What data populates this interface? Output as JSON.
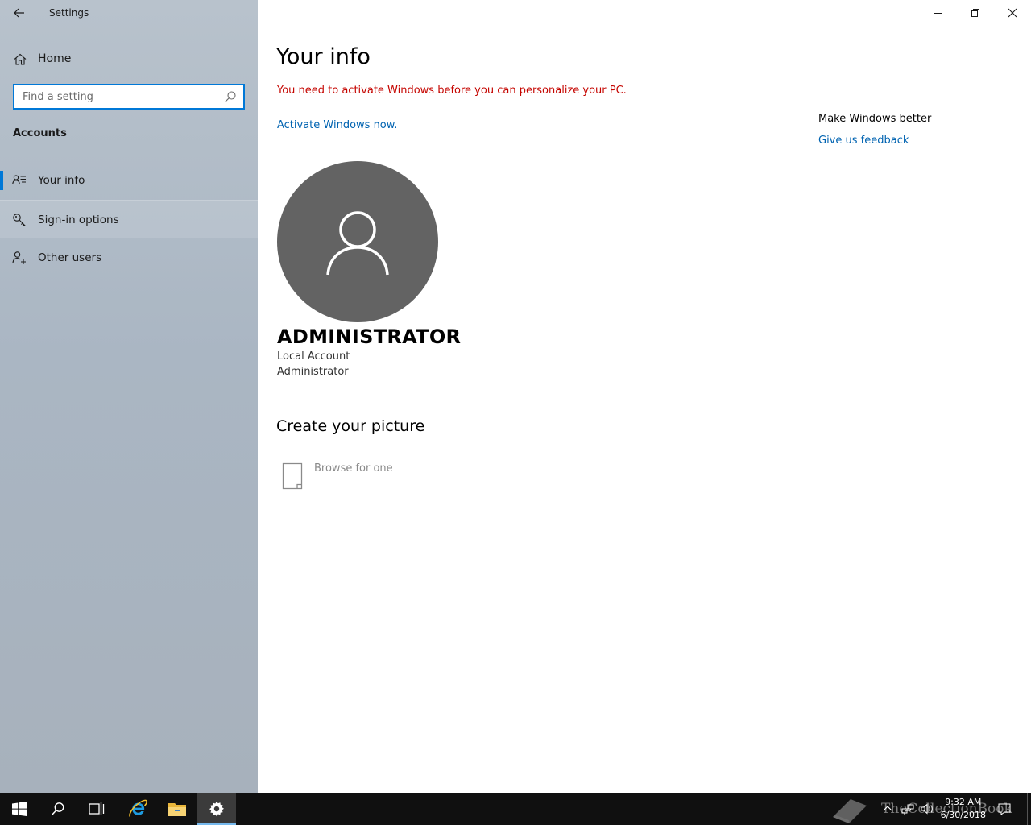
{
  "window": {
    "title": "Settings"
  },
  "sidebar": {
    "home_label": "Home",
    "search_placeholder": "Find a setting",
    "section_title": "Accounts",
    "items": [
      {
        "label": "Your info",
        "icon": "contact-info-icon",
        "selected": true
      },
      {
        "label": "Sign-in options",
        "icon": "key-icon",
        "selected": false
      },
      {
        "label": "Other users",
        "icon": "add-user-icon",
        "selected": false
      }
    ]
  },
  "main": {
    "title": "Your info",
    "activation_warning": "You need to activate Windows before you can personalize your PC.",
    "activate_link": "Activate Windows now.",
    "user": {
      "name": "ADMINISTRATOR",
      "account_type": "Local Account",
      "role": "Administrator"
    },
    "create_picture_heading": "Create your picture",
    "browse_label": "Browse for one"
  },
  "related": {
    "heading": "Make Windows better",
    "feedback_link": "Give us feedback"
  },
  "taskbar": {
    "time": "9:32 AM",
    "date": "6/30/2018",
    "watermark": "TheCollectionBook"
  },
  "colors": {
    "accent": "#0078d7",
    "link": "#0063b1",
    "warning": "#c50500",
    "avatar_bg": "#636363",
    "taskbar_bg": "#101010"
  }
}
